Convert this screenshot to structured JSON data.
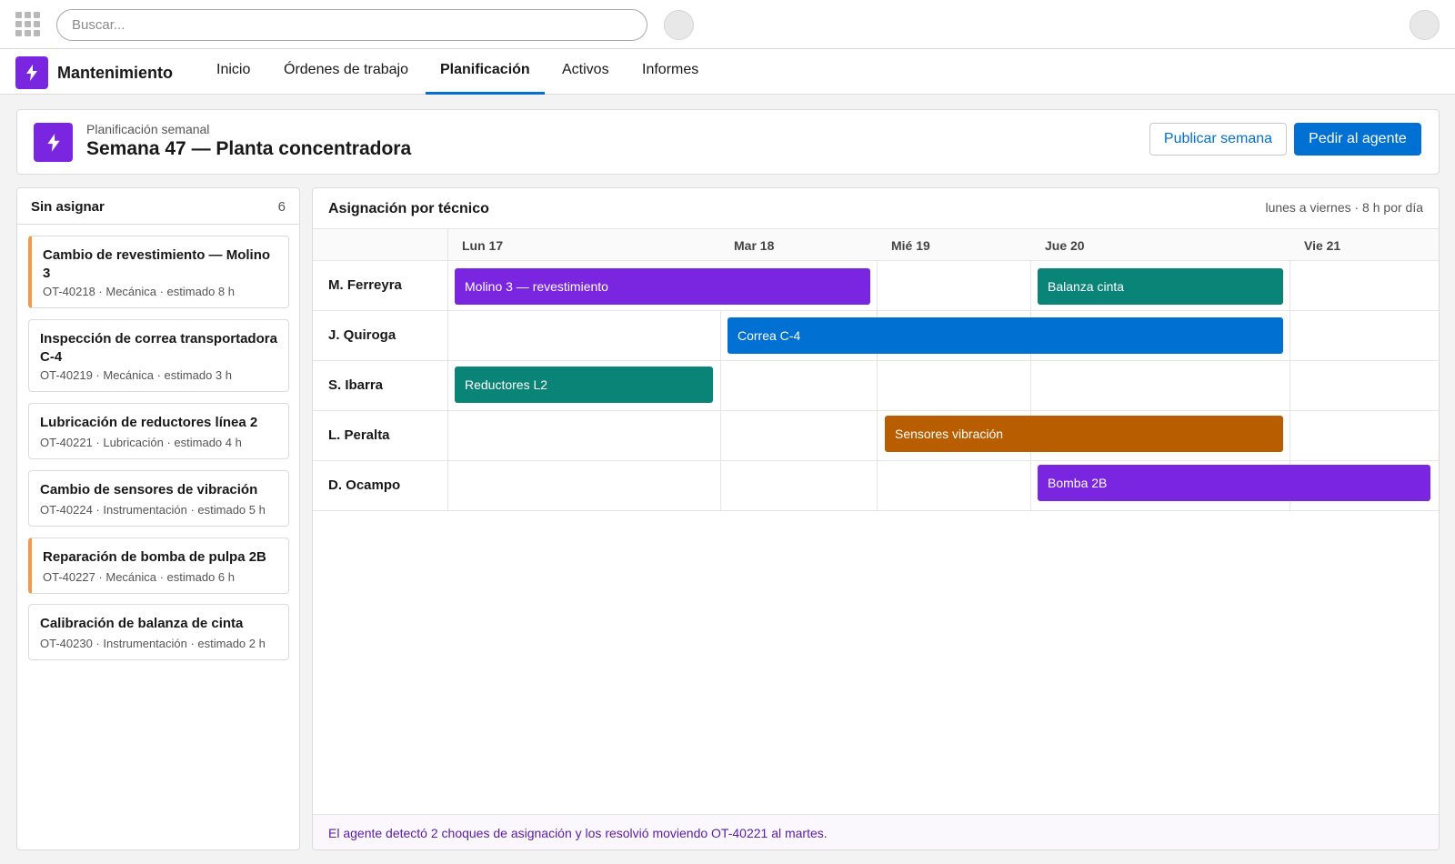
{
  "topbar": {
    "search_placeholder": "Buscar..."
  },
  "nav": {
    "app_name": "Mantenimiento",
    "tabs": [
      {
        "label": "Inicio"
      },
      {
        "label": "Órdenes de trabajo"
      },
      {
        "label": "Planificación",
        "active": true
      },
      {
        "label": "Activos"
      },
      {
        "label": "Informes"
      }
    ]
  },
  "header": {
    "subtitle": "Planificación semanal",
    "title": "Semana 47 — Planta concentradora",
    "publish_label": "Publicar semana",
    "agent_label": "Pedir al agente"
  },
  "unassigned": {
    "title": "Sin asignar",
    "count": "6",
    "items": [
      {
        "title": "Cambio de revestimiento — Molino 3",
        "meta": "OT-40218 · Mecánica · estimado 8 h",
        "flag": true
      },
      {
        "title": "Inspección de correa transportadora C-4",
        "meta": "OT-40219 · Mecánica · estimado 3 h",
        "flag": false
      },
      {
        "title": "Lubricación de reductores línea 2",
        "meta": "OT-40221 · Lubricación · estimado 4 h",
        "flag": false
      },
      {
        "title": "Cambio de sensores de vibración",
        "meta": "OT-40224 · Instrumentación · estimado 5 h",
        "flag": false
      },
      {
        "title": "Reparación de bomba de pulpa 2B",
        "meta": "OT-40227 · Mecánica · estimado 6 h",
        "flag": true
      },
      {
        "title": "Calibración de balanza de cinta",
        "meta": "OT-40230 · Instrumentación · estimado 2 h",
        "flag": false
      }
    ]
  },
  "schedule": {
    "title": "Asignación por técnico",
    "note": "lunes a viernes · 8 h por día",
    "days": [
      "Lun 17",
      "Mar 18",
      "Mié 19",
      "Jue 20",
      "Vie 21"
    ],
    "technicians": [
      "M. Ferreyra",
      "J. Quiroga",
      "S. Ibarra",
      "L. Peralta",
      "D. Ocampo"
    ],
    "assignments": [
      {
        "label": "Molino 3 — revestimiento",
        "color": "#7a26e0"
      },
      {
        "label": "Balanza cinta",
        "color": "#0b8478"
      },
      {
        "label": "Correa C-4",
        "color": "#0070d2"
      },
      {
        "label": "Reductores L2",
        "color": "#0b8478"
      },
      {
        "label": "Sensores vibración",
        "color": "#b85e00"
      },
      {
        "label": "Bomba 2B",
        "color": "#7a26e0"
      }
    ],
    "agent_note": "El agente detectó 2 choques de asignación y los resolvió moviendo OT-40221 al martes."
  },
  "colors": {
    "brand": "#7a26e0",
    "primary": "#0070d2",
    "flag": "#f59a42"
  }
}
